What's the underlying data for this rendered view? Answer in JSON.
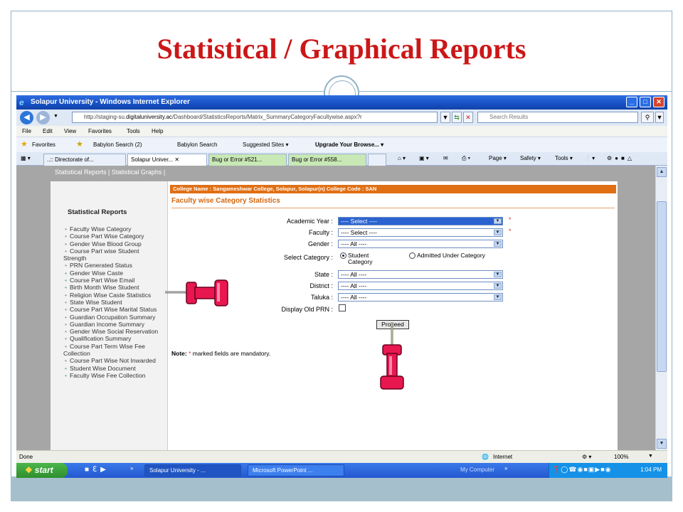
{
  "slide": {
    "title": "Statistical / Graphical Reports"
  },
  "browser": {
    "window_title": "Solapur University - Windows Internet Explorer",
    "address_prefix": "http://staging-su.",
    "address_domain": "digitaluniversity.ac",
    "address_rest": "/Dashboard/StatisticsReports/Matrix_SummaryCategoryFacultywise.aspx?r",
    "search_placeholder": "Search Results",
    "menu": [
      "File",
      "Edit",
      "View",
      "Favorites",
      "Tools",
      "Help"
    ],
    "favorites_label": "Favorites",
    "favorites": [
      "Babylon Search (2)",
      "Babylon Search",
      "Suggested Sites ▾",
      "Upgrade Your Browse... ▾"
    ],
    "tabs": [
      "..:: Directorate of...",
      "Solapur Univer...",
      "Bug or Error #521...",
      "Bug or Error #558..."
    ],
    "commands": [
      "Page ▾",
      "Safety ▾",
      "Tools ▾"
    ],
    "status_left": "Done",
    "status_zone": "Internet",
    "status_zoom": "100%"
  },
  "page": {
    "top_links": "Statistical Reports | Statistical Graphs |",
    "sidebar_heading": "Statistical Reports",
    "sidebar_items": [
      "Faculty Wise Category",
      "Course Part Wise Category",
      "Gender Wise Blood Group",
      "Course Part wise Student Strength",
      "PRN Generated Status",
      "Gender Wise Caste",
      "Course Part Wise  Email",
      "Birth Month Wise Student",
      "Religion Wise Caste Statistics",
      "State Wise Student",
      "Course Part Wise Marital Status",
      "Guardian Occupation Summary",
      "Guardian Income Summary",
      "Gender Wise Social Reservation",
      "Qualification Summary",
      "Course Part Term Wise Fee Collection",
      "Course Part Wise Not Inwarded",
      "Student Wise Document",
      "Faculty Wise Fee Collection"
    ],
    "college_bar": "College Name : Sangameshwar College, Solapur, Solapur(n) College Code : SAN",
    "form_title": "Faculty wise Category Statistics",
    "fields": {
      "academic_year": {
        "label": "Academic Year :",
        "value": "---- Select ----"
      },
      "faculty": {
        "label": "Faculty :",
        "value": "---- Select ----"
      },
      "gender": {
        "label": "Gender :",
        "value": "---- All ----"
      },
      "select_category": {
        "label": "Select Category :",
        "option1": "Student Category",
        "option2": "Admitted Under Category",
        "selected": "Student Category"
      },
      "state": {
        "label": "State :",
        "value": "---- All ----"
      },
      "district": {
        "label": "District :",
        "value": "---- All ----"
      },
      "taluka": {
        "label": "Taluka :",
        "value": "---- All ----"
      },
      "display_old_prn": {
        "label": "Display Old PRN :",
        "checked": false
      }
    },
    "required_mark": "*",
    "proceed_label": "Proceed",
    "note_bold": "Note:",
    "note_star": "*",
    "note_text": "marked fields are mandatory."
  },
  "taskbar": {
    "start_label": "start",
    "items": [
      "Solapur University - ...",
      "Microsoft PowerPoint ..."
    ],
    "my_computer": "My Computer",
    "clock": "1:04 PM"
  },
  "colors": {
    "title_red": "#cc1717",
    "college_bar": "#e06f14",
    "form_title": "#d56710",
    "pin": "#e8174f"
  },
  "icons": [
    "ie-logo-icon",
    "back-icon",
    "forward-icon",
    "search-icon",
    "star-icon",
    "pushpin-icon",
    "windows-flag-icon"
  ]
}
